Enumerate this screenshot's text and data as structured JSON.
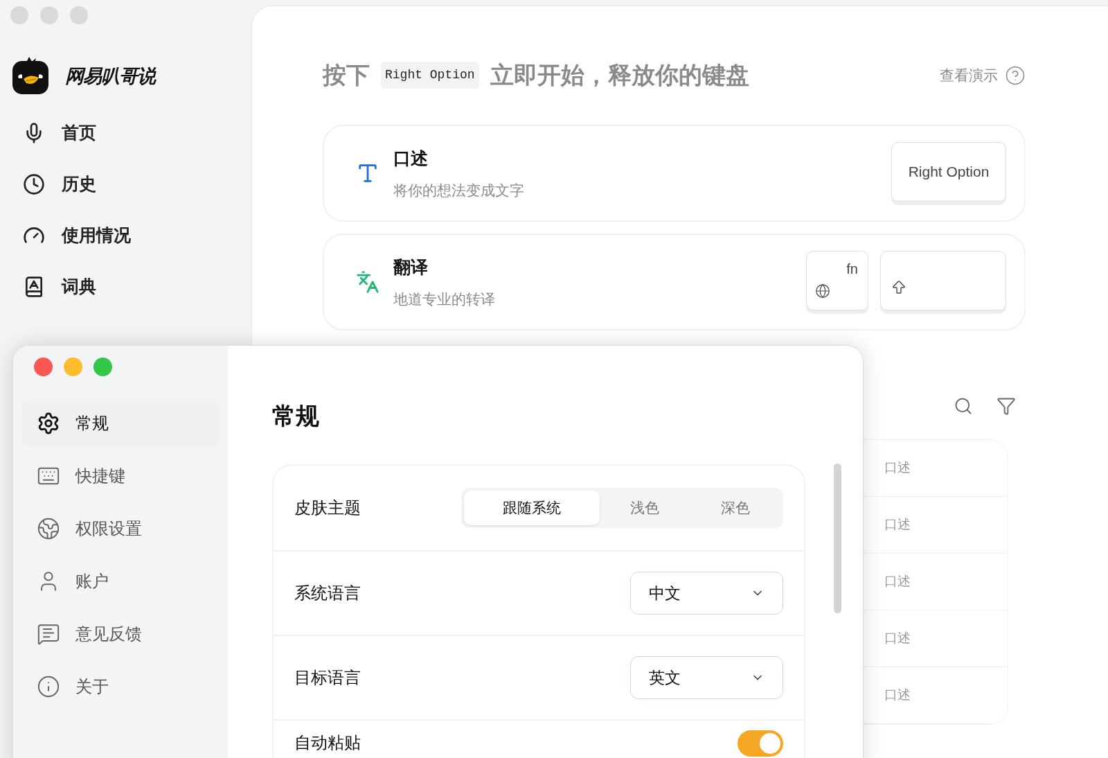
{
  "app_name": "网易叭哥说",
  "nav": [
    {
      "label": "首页"
    },
    {
      "label": "历史"
    },
    {
      "label": "使用情况"
    },
    {
      "label": "词典"
    }
  ],
  "hint": {
    "before": "按下",
    "key": "Right Option",
    "after": "立即开始，释放你的键盘"
  },
  "demo_link": "查看演示",
  "modes": [
    {
      "title": "口述",
      "subtitle": "将你的想法变成文字",
      "color": "#1f6fe0",
      "keys": [
        {
          "kind": "text",
          "label": "Right Option"
        }
      ]
    },
    {
      "title": "翻译",
      "subtitle": "地道专业的转译",
      "color": "#22b573",
      "keys": [
        {
          "kind": "fn",
          "label": "fn"
        },
        {
          "kind": "shift"
        }
      ]
    }
  ],
  "history_rows": [
    {
      "type": "口述"
    },
    {
      "type": "口述"
    },
    {
      "type": "口述"
    },
    {
      "type": "口述"
    },
    {
      "type": "口述"
    }
  ],
  "settings": {
    "nav": [
      {
        "label": "常规",
        "selected": true
      },
      {
        "label": "快捷键",
        "selected": false
      },
      {
        "label": "权限设置",
        "selected": false
      },
      {
        "label": "账户",
        "selected": false
      },
      {
        "label": "意见反馈",
        "selected": false
      },
      {
        "label": "关于",
        "selected": false
      }
    ],
    "title": "常规",
    "rows": [
      {
        "kind": "segmented",
        "label": "皮肤主题",
        "options": [
          {
            "label": "跟随系统",
            "selected": true
          },
          {
            "label": "浅色",
            "selected": false
          },
          {
            "label": "深色",
            "selected": false
          }
        ]
      },
      {
        "kind": "select",
        "label": "系统语言",
        "value": "中文"
      },
      {
        "kind": "select",
        "label": "目标语言",
        "value": "英文"
      },
      {
        "kind": "toggle",
        "label": "自动粘贴",
        "on": true
      }
    ]
  }
}
